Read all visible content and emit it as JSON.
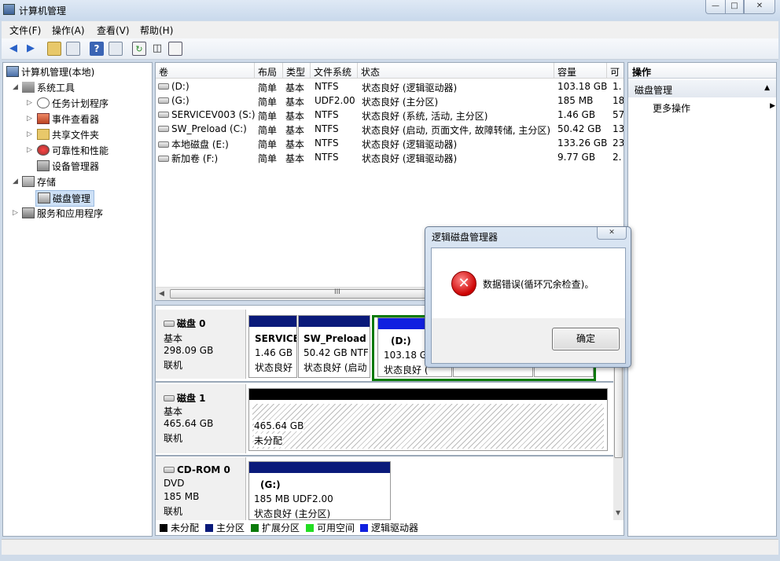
{
  "window": {
    "title": "计算机管理",
    "btn_min": "—",
    "btn_max": "□",
    "btn_close": "✕"
  },
  "menu": [
    "文件(F)",
    "操作(A)",
    "查看(V)",
    "帮助(H)"
  ],
  "toolbar": {
    "back": "back-arrow-icon",
    "forward": "forward-arrow-icon"
  },
  "tree": {
    "root": "计算机管理(本地)",
    "system_tools": "系统工具",
    "task_scheduler": "任务计划程序",
    "event_viewer": "事件查看器",
    "shared_folders": "共享文件夹",
    "reliability": "可靠性和性能",
    "device_manager": "设备管理器",
    "storage": "存储",
    "disk_management": "磁盘管理",
    "services_apps": "服务和应用程序"
  },
  "volume_table": {
    "headers": [
      "卷",
      "布局",
      "类型",
      "文件系统",
      "状态",
      "容量",
      "可"
    ],
    "rows": [
      [
        "(D:)",
        "简单",
        "基本",
        "NTFS",
        "状态良好 (逻辑驱动器)",
        "103.18 GB",
        "1."
      ],
      [
        "(G:)",
        "简单",
        "基本",
        "UDF2.00",
        "状态良好 (主分区)",
        "185 MB",
        "18"
      ],
      [
        "SERVICEV003 (S:)",
        "简单",
        "基本",
        "NTFS",
        "状态良好 (系统, 活动, 主分区)",
        "1.46 GB",
        "57"
      ],
      [
        "SW_Preload (C:)",
        "简单",
        "基本",
        "NTFS",
        "状态良好 (启动, 页面文件, 故障转储, 主分区)",
        "50.42 GB",
        "13"
      ],
      [
        "本地磁盘 (E:)",
        "简单",
        "基本",
        "NTFS",
        "状态良好 (逻辑驱动器)",
        "133.26 GB",
        "23"
      ],
      [
        "新加卷 (F:)",
        "简单",
        "基本",
        "NTFS",
        "状态良好 (逻辑驱动器)",
        "9.77 GB",
        "2."
      ]
    ],
    "scroll_grip": "III"
  },
  "disks": {
    "disk0": {
      "name": "磁盘 0",
      "type": "基本",
      "size": "298.09 GB",
      "status": "联机",
      "p1": {
        "name": "SERVICE",
        "size": "1.46 GB",
        "status": "状态良好"
      },
      "p2": {
        "name": "SW_Preload",
        "size": "50.42 GB NTF",
        "status": "状态良好 (启动"
      },
      "p3": {
        "name": "(D:)",
        "size": "103.18 GE",
        "status": "状态良好 ("
      }
    },
    "disk1": {
      "name": "磁盘 1",
      "type": "基本",
      "size": "465.64 GB",
      "status": "联机",
      "p1": {
        "size": "465.64 GB",
        "status": "未分配"
      }
    },
    "cdrom0": {
      "name": "CD-ROM 0",
      "type": "DVD",
      "size": "185 MB",
      "status": "联机",
      "p1": {
        "name": "(G:)",
        "size": "185 MB UDF2.00",
        "status": "状态良好 (主分区)"
      }
    }
  },
  "legend": [
    {
      "label": "未分配",
      "color": "#000000"
    },
    {
      "label": "主分区",
      "color": "#0a1a7a"
    },
    {
      "label": "扩展分区",
      "color": "#0a7a0a"
    },
    {
      "label": "可用空间",
      "color": "#22dd22"
    },
    {
      "label": "逻辑驱动器",
      "color": "#1020e0"
    }
  ],
  "actions": {
    "header": "操作",
    "section": "磁盘管理",
    "more": "更多操作"
  },
  "dialog": {
    "title": "逻辑磁盘管理器",
    "message": "数据错误(循环冗余检查)。",
    "ok": "确定",
    "close": "✕"
  },
  "colors": {
    "primary_bar": "#0a1a7a",
    "logical_bar": "#1020e0",
    "unallocated_bar": "#000000",
    "extended_border": "#0a7a0a"
  }
}
